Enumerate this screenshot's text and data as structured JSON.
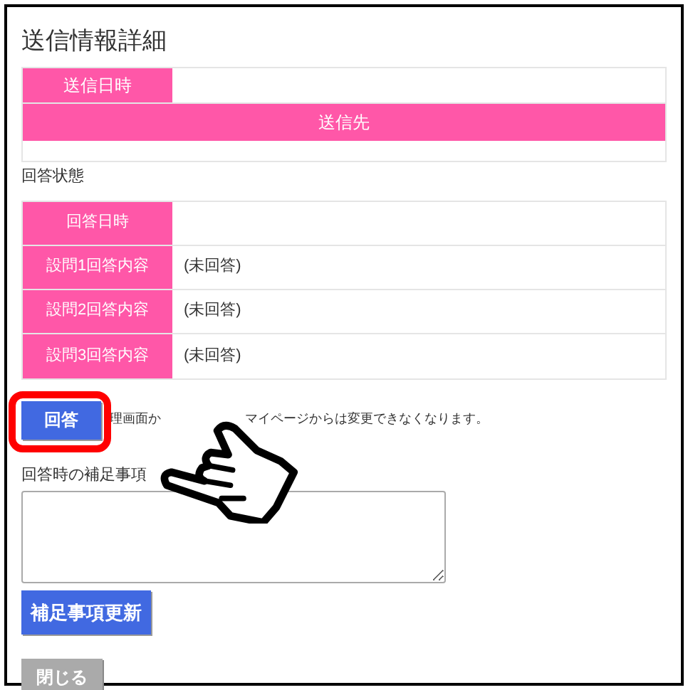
{
  "title": "送信情報詳細",
  "send_table": {
    "rows": [
      {
        "kind": "pair",
        "label": "送信日時"
      },
      {
        "kind": "header",
        "label": "送信先"
      },
      {
        "kind": "blank"
      }
    ]
  },
  "answer_status": {
    "label": "回答状態",
    "rows": [
      {
        "label": "回答日時"
      },
      {
        "label": "設問1回答内容",
        "value": "(未回答)"
      },
      {
        "label": "設問2回答内容",
        "value": "(未回答)"
      },
      {
        "label": "設問3回答内容",
        "value": "(未回答)"
      }
    ]
  },
  "answer_button": {
    "label": "回答",
    "highlighted": true
  },
  "notice_parts": [
    "理画面か",
    "マイページからは変更できなくなります。"
  ],
  "remarks": {
    "label": "回答時の補足事項"
  },
  "update_button": "補足事項更新",
  "close_button": "閉じる",
  "pointer_annotation": true
}
